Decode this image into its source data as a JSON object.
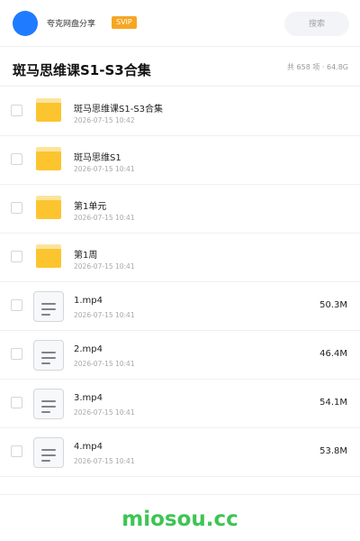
{
  "header": {
    "app_name": "夸克网盘分享",
    "badge": "SVIP",
    "search_placeholder": "搜索"
  },
  "title_bar": {
    "title": "斑马思维课S1-S3合集",
    "meta": "共 658 项 · 64.8G"
  },
  "items": [
    {
      "type": "folder",
      "name": "斑马思维课S1-S3合集",
      "date": "2026-07-15 10:42",
      "size": ""
    },
    {
      "type": "folder",
      "name": "斑马思维S1",
      "date": "2026-07-15 10:41",
      "size": ""
    },
    {
      "type": "folder",
      "name": "第1单元",
      "date": "2026-07-15 10:41",
      "size": ""
    },
    {
      "type": "folder",
      "name": "第1周",
      "date": "2026-07-15 10:41",
      "size": ""
    },
    {
      "type": "file",
      "name": "1.mp4",
      "date": "2026-07-15 10:41",
      "size": "50.3M"
    },
    {
      "type": "file",
      "name": "2.mp4",
      "date": "2026-07-15 10:41",
      "size": "46.4M"
    },
    {
      "type": "file",
      "name": "3.mp4",
      "date": "2026-07-15 10:41",
      "size": "54.1M"
    },
    {
      "type": "file",
      "name": "4.mp4",
      "date": "2026-07-15 10:41",
      "size": "53.8M"
    }
  ],
  "footer": {
    "watermark": "miosou.cc"
  },
  "colors": {
    "accent": "#1f7bff",
    "badge": "#f6a623",
    "folder": "#fcc52f",
    "watermark": "#3ec454"
  }
}
